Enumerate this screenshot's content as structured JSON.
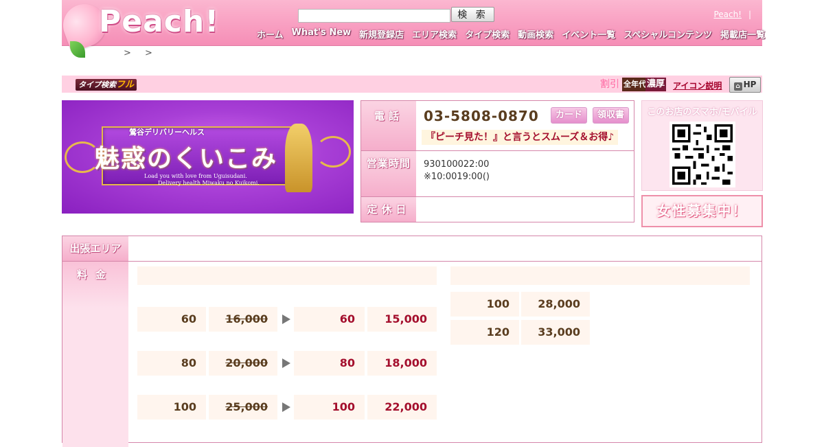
{
  "header": {
    "logo_text": "Peach!",
    "search_placeholder": "",
    "search_button": "検 索",
    "top_link": "Peach!",
    "top_sep": "|",
    "nav": [
      "ホーム",
      "What's New",
      "新規登録店",
      "エリア検索",
      "タイプ検索",
      "動画検索",
      "イベント一覧",
      "スペシャルコンテンツ",
      "掲載店一覧"
    ]
  },
  "breadcrumb": [
    ">",
    ">"
  ],
  "typebar": {
    "badge_prefix": "タイプ検索",
    "badge_suffix": "フル",
    "icons": [
      "割引",
      "全年代",
      "濃厚"
    ],
    "icon_desc": "アイコン説明",
    "hp_button": "HP"
  },
  "banner": {
    "subtitle": "鶯谷デリバリーヘルス",
    "title": "魅惑のくいこみ",
    "english_line1": "Load you with love from Uguisudani.",
    "english_line2": "Delivery health Miwaku no Kuikomi."
  },
  "info": {
    "phone_label": "電話",
    "phone": "03-5808-0870",
    "card": "カード",
    "receipt": "領収書",
    "promo": "『ピーチ見た！』と言うとスムーズ＆お得♪",
    "hours_label": "営業時間",
    "hours_line1": "930100022:00",
    "hours_line2": "※10:0019:00()",
    "holiday_label": "定休日",
    "holiday_value": ""
  },
  "side": {
    "qr_title": "このお店のスマホ/モバイル",
    "recruit": "女性募集中！"
  },
  "bottom": {
    "area_label": "出張エリア",
    "fee_label": "料金",
    "left_prices": [
      {
        "time": "60",
        "old": "16,000",
        "new_time": "60",
        "new": "15,000"
      },
      {
        "time": "80",
        "old": "20,000",
        "new_time": "80",
        "new": "18,000"
      },
      {
        "time": "100",
        "old": "25,000",
        "new_time": "100",
        "new": "22,000"
      }
    ],
    "right_prices": [
      {
        "time": "100",
        "price": "28,000"
      },
      {
        "time": "120",
        "price": "33,000"
      }
    ]
  },
  "colors": {
    "header_pink": "#f9a3c4",
    "label_pink": "#f5aecb",
    "price_brown": "#5a3d1f",
    "price_red": "#a40f2d"
  }
}
